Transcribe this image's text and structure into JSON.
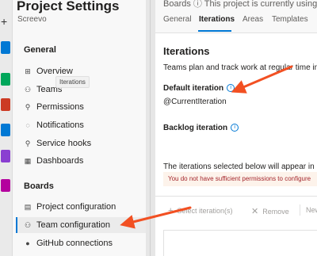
{
  "rail": {
    "plus": "+",
    "icon_colors": [
      "#0078d4",
      "#00a65a",
      "#cc3a23",
      "#0078d4",
      "#8a3fd1",
      "#b4009e"
    ]
  },
  "nav": {
    "project_title": "Project Settings",
    "project_name": "Screevo",
    "sections": {
      "general": "General",
      "boards": "Boards"
    },
    "general_items": [
      {
        "label": "Overview",
        "icon": "overview-icon",
        "glyph": "⊞"
      },
      {
        "label": "Teams",
        "icon": "teams-icon",
        "glyph": "⚇"
      },
      {
        "label": "Permissions",
        "icon": "lock-icon",
        "glyph": "🔒"
      },
      {
        "label": "Notifications",
        "icon": "chat-icon",
        "glyph": "◌"
      },
      {
        "label": "Service hooks",
        "icon": "hook-icon",
        "glyph": "⚲"
      },
      {
        "label": "Dashboards",
        "icon": "dashboard-icon",
        "glyph": "▦"
      }
    ],
    "boards_items": [
      {
        "label": "Project configuration",
        "icon": "document-icon",
        "glyph": "▤"
      },
      {
        "label": "Team configuration",
        "icon": "team-config-icon",
        "glyph": "⚇"
      },
      {
        "label": "GitHub connections",
        "icon": "github-icon",
        "glyph": "●"
      }
    ],
    "tooltip": "Iterations"
  },
  "main": {
    "topbar_clip": "Boards      ⓘ This project is currently using",
    "tabs": [
      "General",
      "Iterations",
      "Areas",
      "Templates"
    ],
    "active_tab": "Iterations",
    "title": "Iterations",
    "description": "Teams plan and track work at regular time intervals",
    "default_iteration_label": "Default iteration",
    "default_iteration_value": "@CurrentIteration",
    "backlog_iteration_label": "Backlog iteration",
    "selected_text": "The iterations selected below will appear in",
    "warning": "You do not have sufficient permissions to configure",
    "toolbar": {
      "select": "Select iteration(s)",
      "remove": "Remove",
      "new": "New"
    },
    "info_glyph": "i",
    "accent": "#0078d4",
    "arrow_color": "#f25022"
  }
}
